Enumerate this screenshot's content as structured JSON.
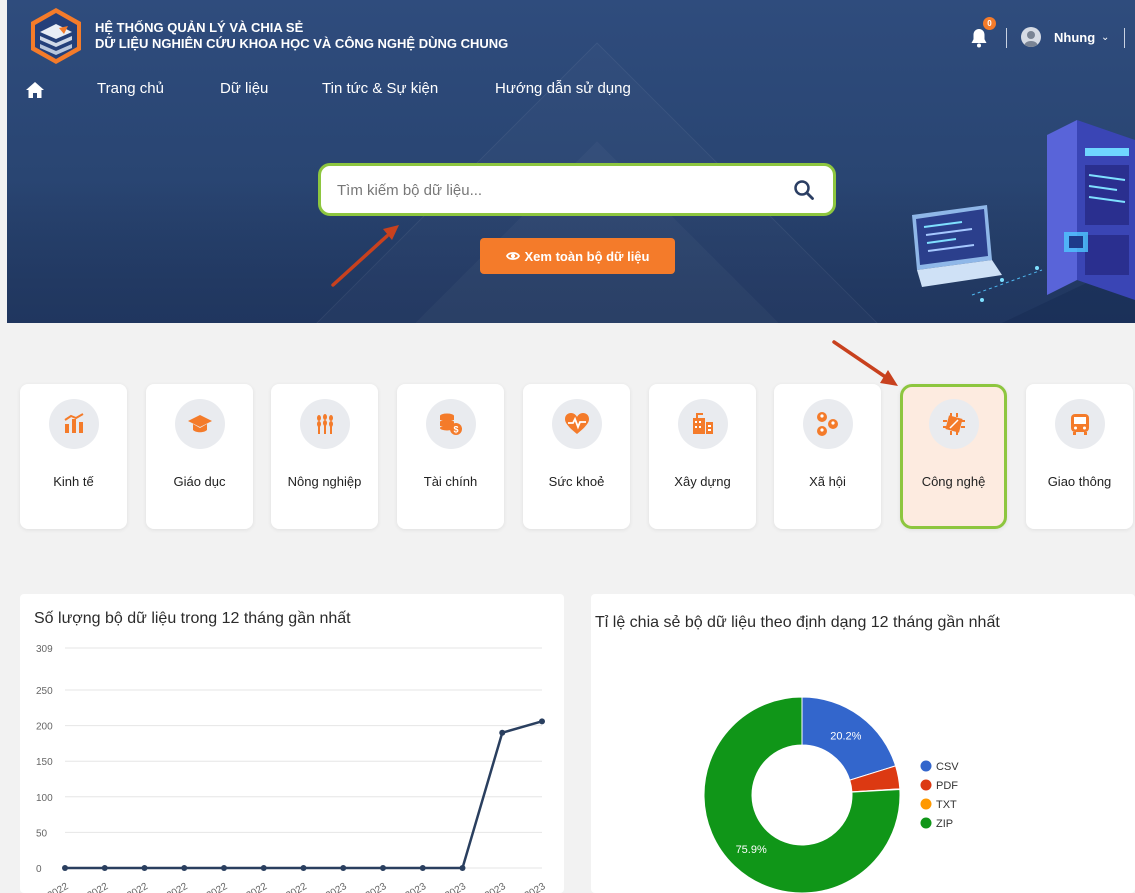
{
  "header": {
    "title_line1": "HỆ THỐNG QUẢN LÝ VÀ CHIA SẺ",
    "title_line2": "DỮ LIỆU NGHIÊN CỨU KHOA HỌC VÀ CÔNG NGHỆ DÙNG CHUNG",
    "notification_count": "0",
    "user_name": "Nhung"
  },
  "nav": {
    "items": [
      "Trang chủ",
      "Dữ liệu",
      "Tin tức & Sự kiện",
      "Hướng dẫn sử dụng"
    ]
  },
  "search": {
    "placeholder": "Tìm kiếm bộ dữ liệu...",
    "value": ""
  },
  "view_all_label": "Xem toàn bộ dữ liệu",
  "categories": [
    {
      "label": "Kinh tế"
    },
    {
      "label": "Giáo dục"
    },
    {
      "label": "Nông nghiệp"
    },
    {
      "label": "Tài chính"
    },
    {
      "label": "Sức khoẻ"
    },
    {
      "label": "Xây dựng"
    },
    {
      "label": "Xã hội"
    },
    {
      "label": "Công nghệ"
    },
    {
      "label": "Giao thông"
    }
  ],
  "colors": {
    "accent_orange": "#f47b2a",
    "highlight_green": "#8dc63f",
    "hero_blue": "#2b4774",
    "line_series": "#2a3f5f"
  },
  "line_chart_card": {
    "title": "Số lượng bộ dữ liệu trong 12 tháng gần nhất"
  },
  "donut_chart_card": {
    "title": "Tỉ lệ chia sẻ bộ dữ liệu theo định dạng 12 tháng gần nhất"
  },
  "chart_data": [
    {
      "type": "line",
      "title": "Số lượng bộ dữ liệu trong 12 tháng gần nhất",
      "x": [
        "2022",
        "2022",
        "2022",
        "2022",
        "2022",
        "2022",
        "2022",
        "2023",
        "2023",
        "2023",
        "2023",
        "2023",
        "2023"
      ],
      "series": [
        {
          "values": [
            0,
            0,
            0,
            0,
            0,
            0,
            0,
            0,
            0,
            0,
            0,
            190,
            206
          ]
        }
      ],
      "yticks": [
        "0",
        "50",
        "100",
        "150",
        "200",
        "250",
        "309"
      ],
      "ylim": [
        0,
        309
      ],
      "grid": true
    },
    {
      "type": "pie",
      "title": "Tỉ lệ chia sẻ bộ dữ liệu theo định dạng 12 tháng gần nhất",
      "donut": true,
      "labels": [
        "CSV",
        "PDF",
        "TXT",
        "ZIP"
      ],
      "values": [
        20.2,
        3.8,
        0.1,
        75.9
      ],
      "value_labels": [
        "20.2%",
        "",
        "",
        "75.9%"
      ],
      "colors": [
        "#3366cc",
        "#dc3912",
        "#ff9900",
        "#109618"
      ],
      "legend": "right"
    }
  ]
}
